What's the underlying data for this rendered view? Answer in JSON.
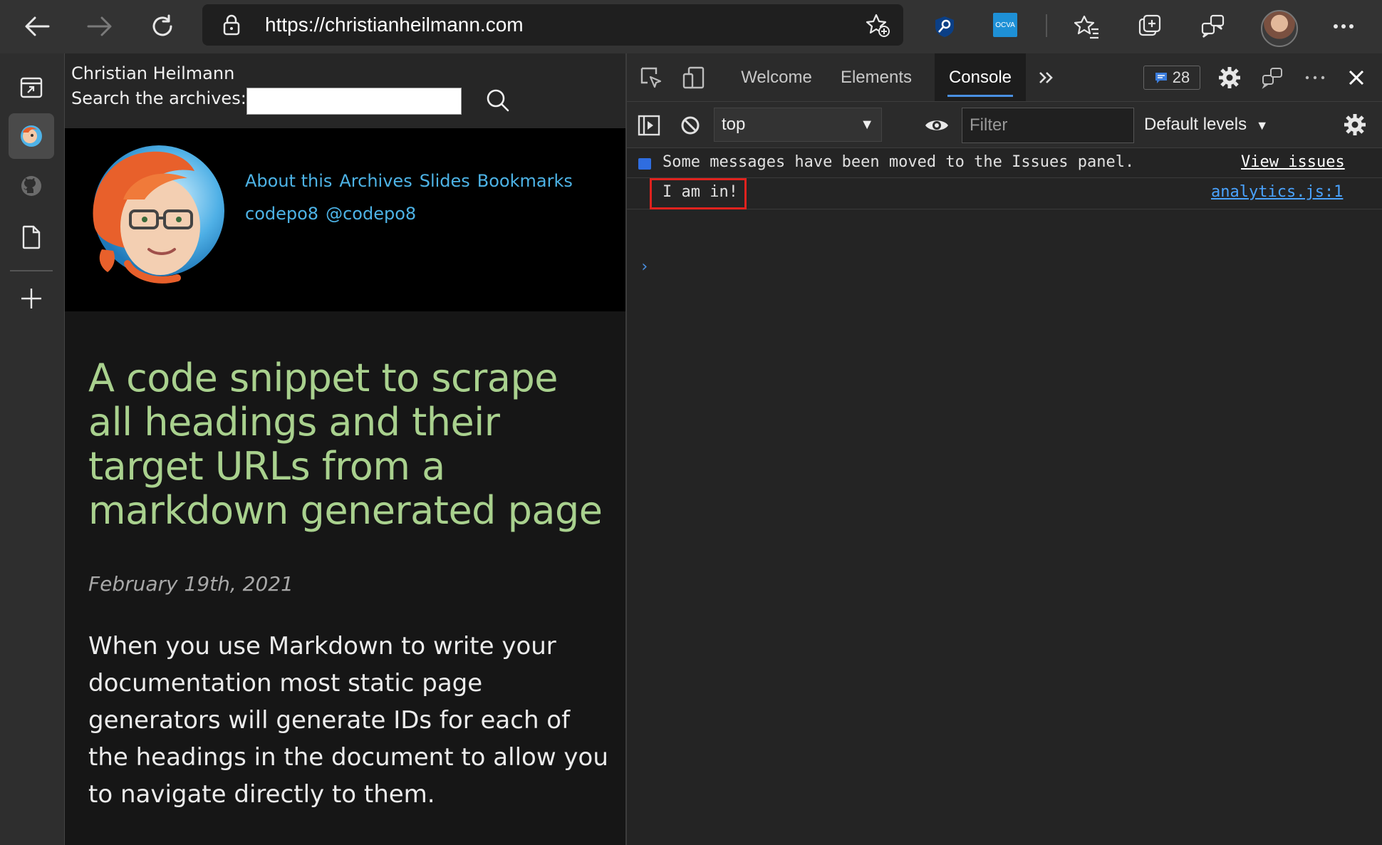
{
  "browser": {
    "url_scheme": "https://",
    "url_host": "christianheilmann.com",
    "ext_ocva_label": "OCVA"
  },
  "webpage": {
    "site_name": "Christian Heilmann",
    "search_label": "Search the archives:",
    "search_value": "",
    "nav_links": [
      "About this",
      "Archives",
      "Slides",
      "Bookmarks"
    ],
    "social_links": [
      "codepo8",
      "@codepo8"
    ],
    "article": {
      "title": "A code snippet to scrape all headings and their target URLs from a markdown generated page",
      "date": "February 19th, 2021",
      "body": "When you use Markdown to write your documentation most static page generators will generate IDs for each of the headings in the document to allow you to navigate directly to them."
    }
  },
  "devtools": {
    "tabs": [
      {
        "label": "Welcome",
        "active": false
      },
      {
        "label": "Elements",
        "active": false
      },
      {
        "label": "Console",
        "active": true
      }
    ],
    "issues_count": "28",
    "context": "top",
    "filter_placeholder": "Filter",
    "levels_label": "Default levels",
    "messages": [
      {
        "type": "info",
        "text": "Some messages have been moved to the Issues panel.",
        "action": "View issues"
      },
      {
        "type": "log",
        "text": "I am in!",
        "source": "analytics.js:1"
      }
    ],
    "prompt": "›"
  },
  "colors": {
    "accent": "#4a90e2",
    "highlight": "#e0221e",
    "title_green": "#a9d18e",
    "link_blue": "#4db3e6"
  }
}
